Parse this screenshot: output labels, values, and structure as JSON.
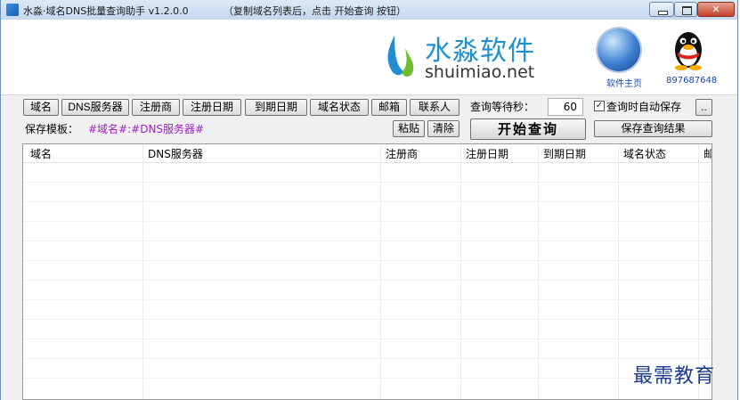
{
  "window": {
    "title": "水淼·域名DNS批量查询助手 v1.2.0.0",
    "hint": "（复制域名列表后，点击 开始查询 按钮）"
  },
  "header": {
    "brand_cn": "水淼软件",
    "brand_en": "shuimiao.net",
    "homepage_label": "软件主页",
    "qq_label": "897687648"
  },
  "toolbar": {
    "field_buttons": [
      "域名",
      "DNS服务器",
      "注册商",
      "注册日期",
      "到期日期",
      "域名状态",
      "邮箱",
      "联系人"
    ],
    "wait_label": "查询等待秒：",
    "wait_value": "60",
    "auto_save_checked": true,
    "auto_save_label": "查询时自动保存",
    "more_button": "..",
    "template_label": "保存模板：",
    "template_value": "#域名#:#DNS服务器#",
    "paste_button": "粘贴",
    "clear_button": "清除",
    "start_button": "开始查询",
    "save_results_button": "保存查询结果"
  },
  "grid": {
    "columns": [
      "域名",
      "DNS服务器",
      "注册商",
      "注册日期",
      "到期日期",
      "域名状态",
      "邮"
    ]
  },
  "watermark": "最需教育",
  "colors": {
    "brand_blue": "#1f8fd0",
    "template_purple": "#a020c8",
    "link_blue": "#1448b8"
  }
}
